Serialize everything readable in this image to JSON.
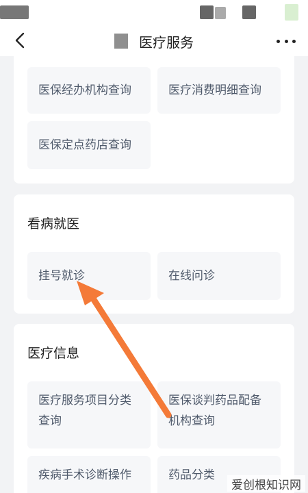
{
  "nav": {
    "title": "医疗服务"
  },
  "sections": [
    {
      "title": "",
      "items": [
        "医保经办机构查询",
        "医疗消费明细查询",
        "医保定点药店查询"
      ]
    },
    {
      "title": "看病就医",
      "items": [
        "挂号就诊",
        "在线问诊"
      ]
    },
    {
      "title": "医疗信息",
      "items": [
        "医疗服务项目分类\n查询",
        "医保谈判药品配备\n机构查询",
        "疾病手术诊断操作",
        "药品分类"
      ]
    }
  ],
  "watermark": "爱创根知识网",
  "annotation": {
    "color": "#f47a38",
    "target": "挂号就诊"
  }
}
